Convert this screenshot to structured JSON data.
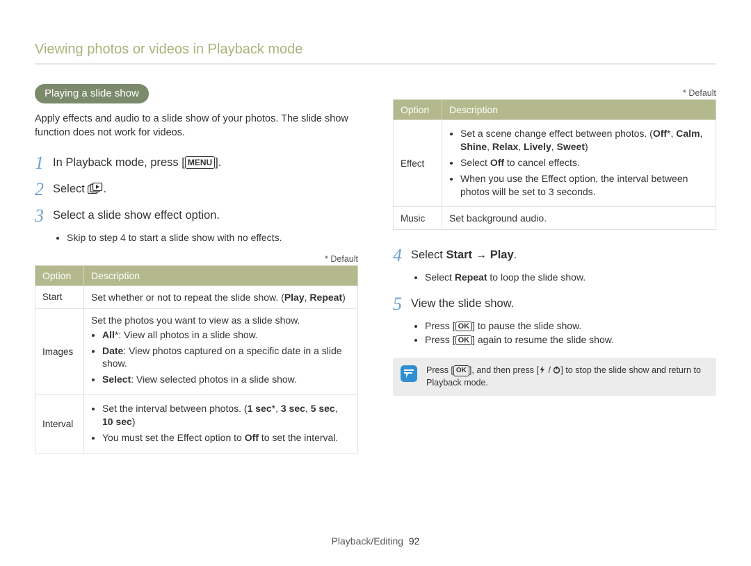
{
  "header": {
    "section_title": "Viewing photos or videos in Playback mode"
  },
  "left": {
    "pill": "Playing a slide show",
    "intro": "Apply effects and audio to a slide show of your photos. The slide show function does not work for videos.",
    "steps": {
      "s1_pre": "In Playback mode, press [",
      "s1_menu": "MENU",
      "s1_post": "].",
      "s2_pre": "Select ",
      "s2_post": ".",
      "s3": "Select a slide show effect option.",
      "s3_bullet": "Skip to step 4 to start a slide show with no effects."
    },
    "default_label": "* Default",
    "table": {
      "h1": "Option",
      "h2": "Description",
      "start_name": "Start",
      "start_desc_pre": "Set whether or not to repeat the slide show. (",
      "start_opt1": "Play",
      "start_sep": ", ",
      "start_opt2": "Repeat",
      "start_desc_post": ")",
      "images_name": "Images",
      "images_line1": "Set the photos you want to view as a slide show.",
      "images_b1_label": "All",
      "images_b1_star": "*",
      "images_b1_rest": ": View all photos in a slide show.",
      "images_b2_label": "Date",
      "images_b2_rest": ": View photos captured on a specific date in a slide show.",
      "images_b3_label": "Select",
      "images_b3_rest": ": View selected photos in a slide show.",
      "interval_name": "Interval",
      "interval_l1_pre": "Set the interval between photos. (",
      "interval_o1": "1 sec",
      "interval_star": "*",
      "interval_sep1": ", ",
      "interval_o2": "3 sec",
      "interval_sep2": ", ",
      "interval_o3": "5 sec",
      "interval_sep3": ", ",
      "interval_o4": "10 sec",
      "interval_l1_post": ")",
      "interval_l2_pre": "You must set the Effect option to ",
      "interval_l2_off": "Off",
      "interval_l2_post": " to set the interval."
    }
  },
  "right": {
    "default_label": "* Default",
    "table": {
      "h1": "Option",
      "h2": "Description",
      "effect_name": "Effect",
      "effect_l1_pre": "Set a scene change effect between photos. (",
      "effect_o1": "Off",
      "effect_star": "*",
      "effect_sep": ", ",
      "effect_o2": "Calm",
      "effect_o3": "Shine",
      "effect_o4": "Relax",
      "effect_o5": "Lively",
      "effect_o6": "Sweet",
      "effect_l1_post": ")",
      "effect_l2_pre": "Select ",
      "effect_l2_off": "Off",
      "effect_l2_post": " to cancel effects.",
      "effect_l3": "When you use the Effect option, the interval between photos will be set to 3 seconds.",
      "music_name": "Music",
      "music_desc": "Set background audio."
    },
    "steps": {
      "s4_pre": "Select ",
      "s4_start": "Start",
      "s4_arrow": " → ",
      "s4_play": "Play",
      "s4_post": ".",
      "s4_bullet_pre": "Select ",
      "s4_bullet_repeat": "Repeat",
      "s4_bullet_post": " to loop the slide show.",
      "s5": "View the slide show.",
      "s5_b1_pre": "Press [",
      "s5_ok": "OK",
      "s5_b1_post": "] to pause the slide show.",
      "s5_b2_pre": "Press [",
      "s5_b2_post": "] again to resume the slide show."
    },
    "tip": {
      "pre": "Press [",
      "ok": "OK",
      "mid": "], and then press [",
      "post": "] to stop the slide show and return to Playback mode."
    }
  },
  "footer": {
    "section": "Playback/Editing",
    "page": "92"
  }
}
